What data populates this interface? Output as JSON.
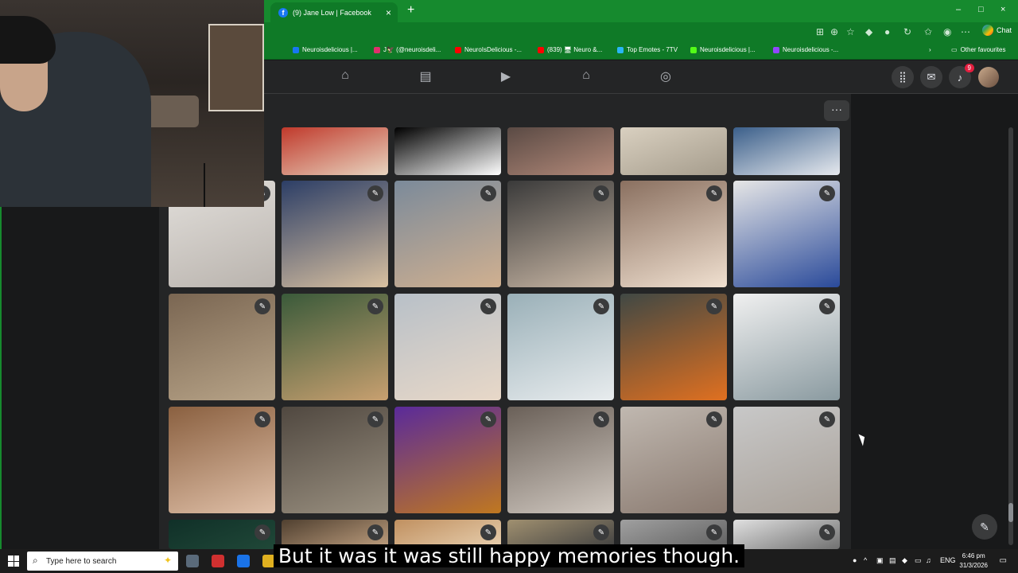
{
  "browser": {
    "tab_title": "(9) Jane Low | Facebook",
    "tab_close": "×",
    "new_tab": "+",
    "window_controls": [
      "–",
      "□",
      "×"
    ],
    "chat_label": "Chat",
    "bookmarks": [
      {
        "label": "Neuroisdelicious |...",
        "color": "#1877f2"
      },
      {
        "label": "J🦅 (@neuroisdeli...",
        "color": "#e1306c"
      },
      {
        "label": "NeuroIsDelicious -...",
        "color": "#ff0000"
      },
      {
        "label": "(839) 🖥 Neuro &...",
        "color": "#ff0000"
      },
      {
        "label": "Top Emotes - 7TV",
        "color": "#29b6f6"
      },
      {
        "label": "Neuroisdelicious |...",
        "color": "#53fc18"
      },
      {
        "label": "Neuroisdelicious -...",
        "color": "#9146ff"
      }
    ],
    "other_favourites": "Other favourites"
  },
  "facebook": {
    "nav_icons": [
      "home-icon",
      "feeds-icon",
      "video-icon",
      "marketplace-icon",
      "groups-icon"
    ],
    "right_icons": [
      "menu-grid-icon",
      "messenger-icon",
      "notifications-icon"
    ],
    "notification_count": "9",
    "more_label": "···",
    "edit_glyph": "✎",
    "compose_glyph": "✎",
    "photo_palettes": [
      [
        "#c0392b",
        "#e8d5c0"
      ],
      [
        "#000000",
        "#ffffff"
      ],
      [
        "#5a4a44",
        "#b48a7a"
      ],
      [
        "#d9d0c0",
        "#a59c8c"
      ],
      [
        "#3b5f8a",
        "#e6e9ee"
      ],
      [
        "#e2dfdb",
        "#b9b3ad"
      ],
      [
        "#2c3e66",
        "#d8c0a0"
      ],
      [
        "#7b8a9a",
        "#d0b090"
      ],
      [
        "#3a3a3a",
        "#c9b7a5"
      ],
      [
        "#8a7060",
        "#f0e0d0"
      ],
      [
        "#e6e6e6",
        "#2a4a9a"
      ],
      [
        "#7a6652",
        "#b8a488"
      ],
      [
        "#3a5a3a",
        "#c8a070"
      ],
      [
        "#b8c0c8",
        "#e8d8c8"
      ],
      [
        "#9ab0b8",
        "#e8ecee"
      ],
      [
        "#404844",
        "#e07020"
      ],
      [
        "#f0f0f0",
        "#8a9aa0"
      ],
      [
        "#8a6040",
        "#e0c0a8"
      ],
      [
        "#504840",
        "#9a9080"
      ],
      [
        "#5a2a9a",
        "#c07820"
      ],
      [
        "#6a6058",
        "#d0c8c0"
      ],
      [
        "#c0b8b0",
        "#8a7a70"
      ],
      [
        "#c8c8c8",
        "#a8a098"
      ],
      [
        "#103028",
        "#204838"
      ],
      [
        "#504030",
        "#c0a080"
      ],
      [
        "#c09060",
        "#e8d0b0"
      ],
      [
        "#a09070",
        "#404040"
      ],
      [
        "#a0a0a0",
        "#606060"
      ],
      [
        "#e0e0e0",
        "#707070"
      ]
    ]
  },
  "taskbar": {
    "search_placeholder": "Type here to search",
    "language": "ENG",
    "time": "6:46 pm",
    "date": "31/3/2026"
  },
  "caption": "But it was it was still happy memories though."
}
